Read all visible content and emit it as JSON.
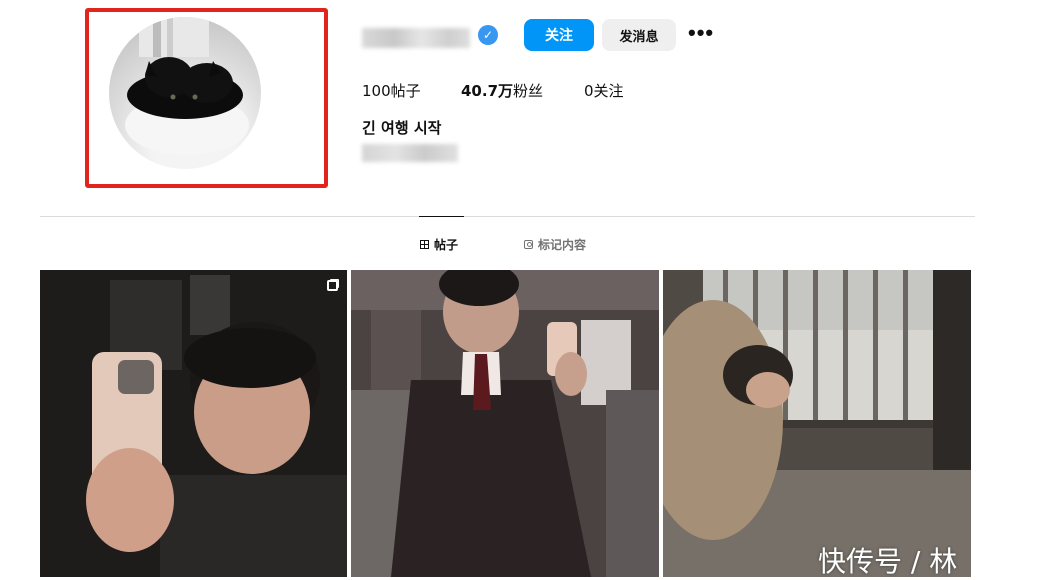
{
  "profile": {
    "follow_label": "关注",
    "message_label": "发消息",
    "more_label": "•••",
    "verified_mark": "✓"
  },
  "stats": {
    "posts_count": "100",
    "posts_label": "帖子",
    "followers_count": "40.7万",
    "followers_label": "粉丝",
    "following_count": "0",
    "following_label": "关注"
  },
  "bio": {
    "name": "긴 여행 시작"
  },
  "tabs": [
    {
      "label": "帖子",
      "icon": "grid-icon",
      "active": true
    },
    {
      "label": "标记内容",
      "icon": "tag-icon",
      "active": false
    }
  ],
  "posts": [
    {
      "icon": "multiple-photos-icon"
    },
    {},
    {}
  ],
  "watermark": "快传号 / 林",
  "colors": {
    "follow_button": "#0095f6",
    "highlight_frame": "#e0261c",
    "verified_badge": "#3897f0"
  }
}
